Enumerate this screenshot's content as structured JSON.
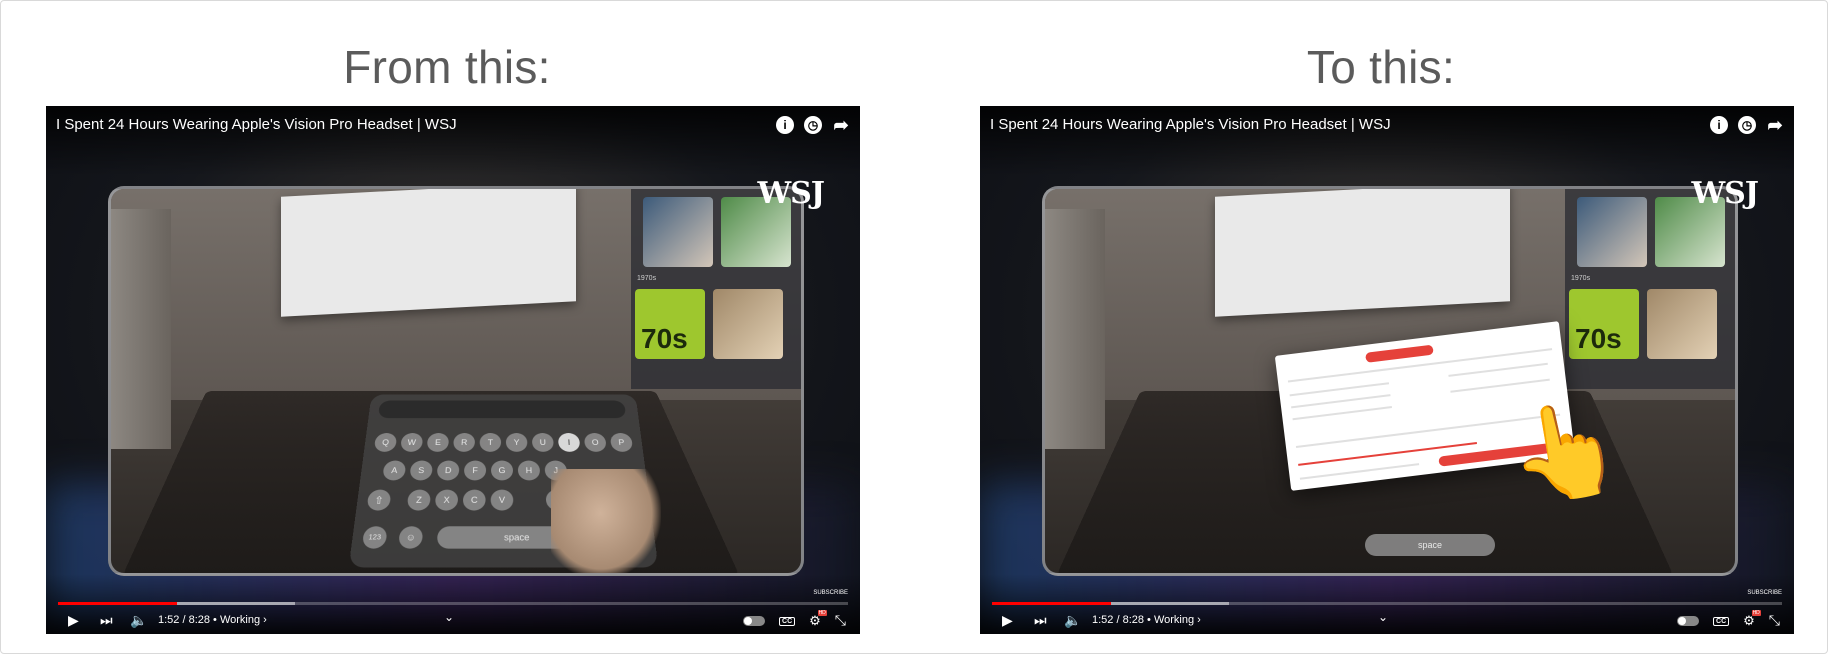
{
  "headings": {
    "left": "From this:",
    "right": "To this:"
  },
  "video": {
    "title": "I Spent 24 Hours Wearing Apple's Vision Pro Headset | WSJ",
    "brand": "WSJ",
    "time": "1:52 / 8:28 • Working ›",
    "subscribe": "SUBSCRIBE",
    "progress_played": 0.15,
    "progress_buffered": 0.3
  },
  "music_panel": {
    "row_label": "1970s",
    "album3_text": "70s"
  },
  "keyboard": {
    "rows": [
      [
        "Q",
        "W",
        "E",
        "R",
        "T",
        "Y",
        "U",
        "I",
        "O",
        "P"
      ],
      [
        "A",
        "S",
        "D",
        "F",
        "G",
        "H",
        "J"
      ],
      [
        "Z",
        "X",
        "C",
        "V",
        "N"
      ]
    ],
    "numbers_key": "123",
    "space_label": "space"
  },
  "icons": {
    "info": "info-icon",
    "watch_later": "clock-icon",
    "share": "share-icon",
    "play": "play-icon",
    "next": "next-icon",
    "volume": "volume-icon",
    "autoplay": "autoplay-toggle-icon",
    "captions": "cc-icon",
    "settings": "settings-gear-icon",
    "exit_fullscreen": "exit-fullscreen-icon",
    "pointing_hand": "pointing-hand-icon"
  },
  "colors": {
    "progress_red": "#ff0000",
    "accent_red": "#e5413a"
  }
}
